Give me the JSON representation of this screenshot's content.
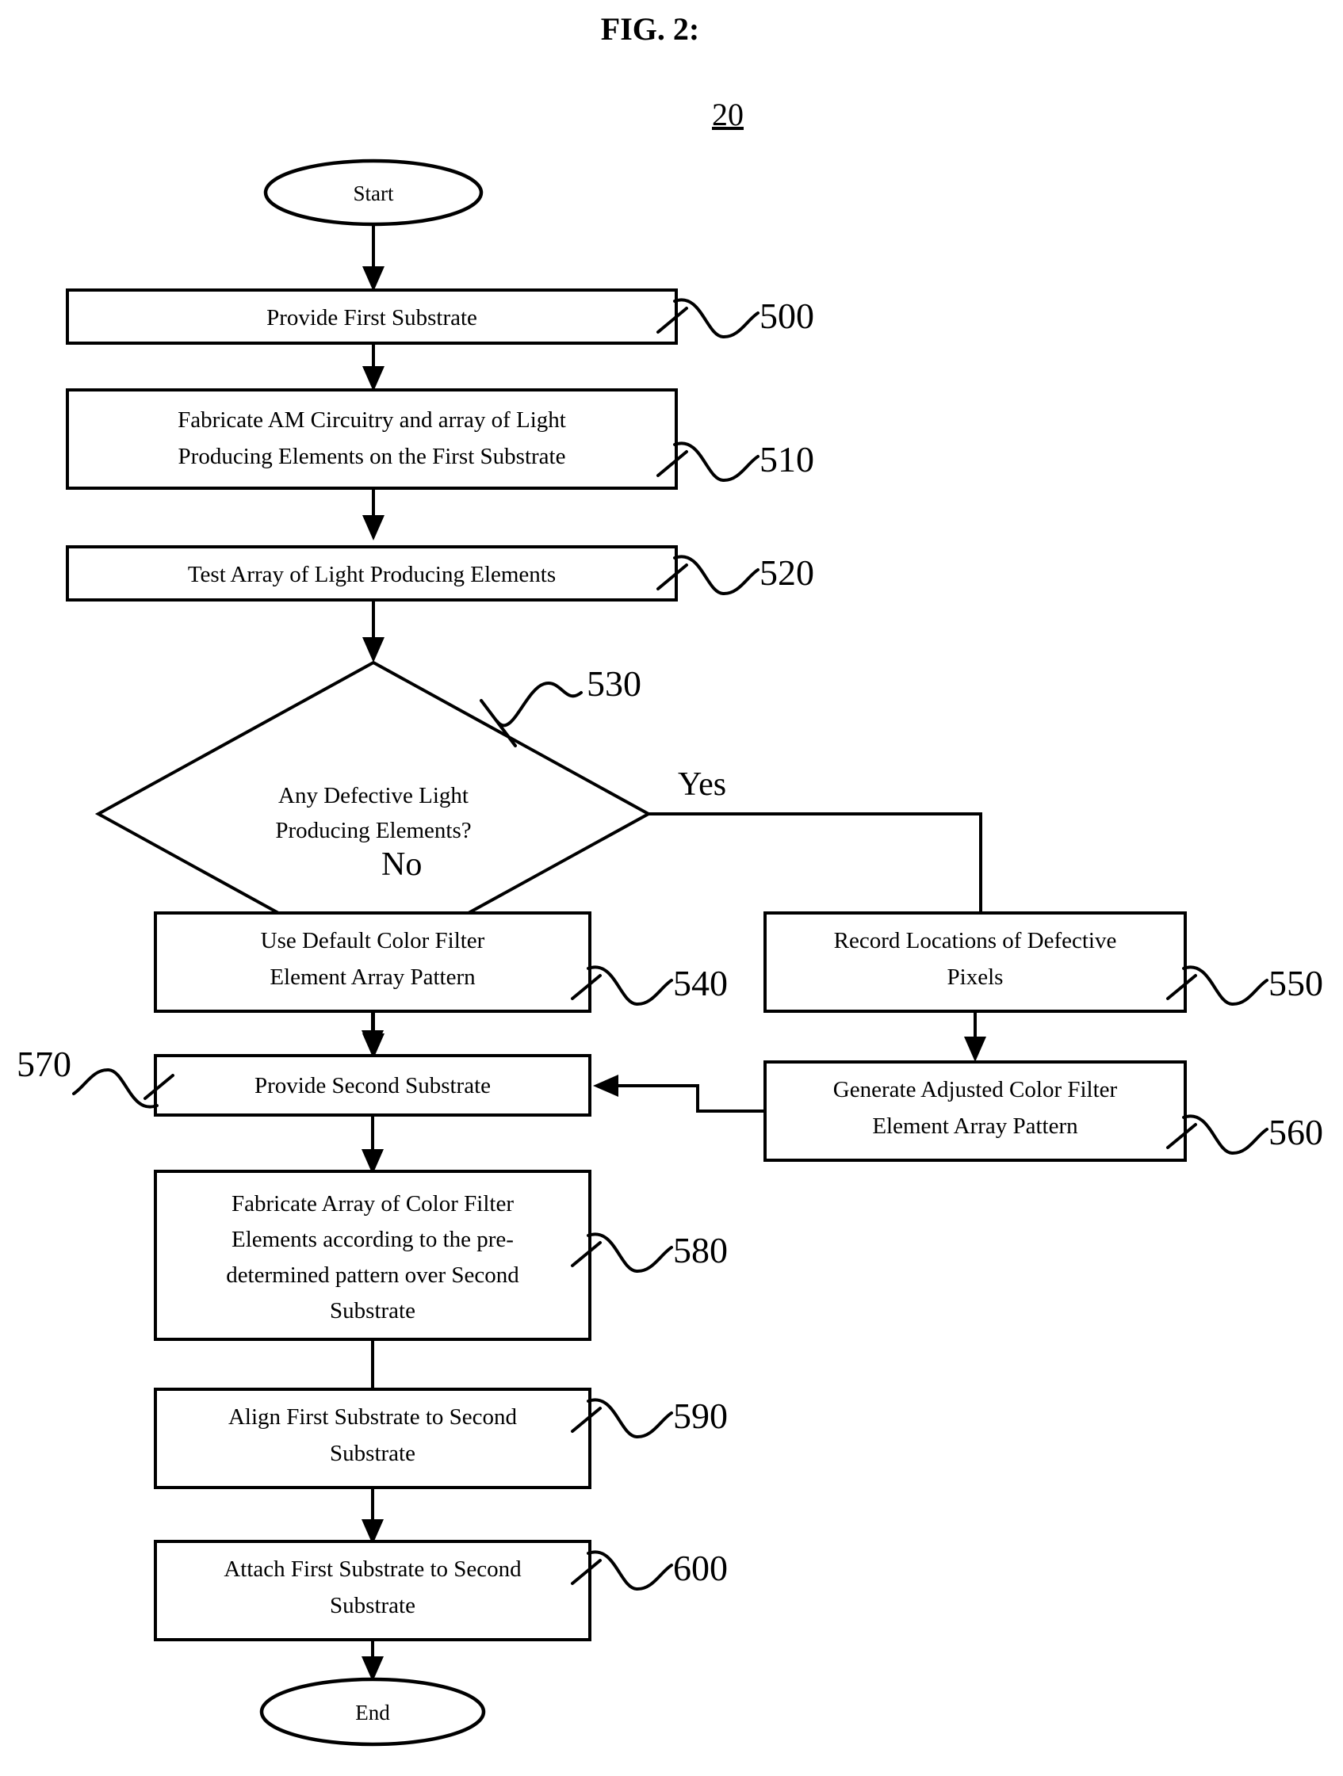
{
  "figure": {
    "title": "FIG. 2:",
    "diagram_number": "20"
  },
  "terminals": {
    "start": "Start",
    "end": "End"
  },
  "branch_labels": {
    "yes": "Yes",
    "no": "No"
  },
  "nodes": [
    {
      "id": "n500",
      "shape": "process",
      "lines": [
        "Provide First Substrate"
      ],
      "ref": "500"
    },
    {
      "id": "n510",
      "shape": "process",
      "lines": [
        "Fabricate AM Circuitry and array of Light",
        "Producing Elements on the First Substrate"
      ],
      "ref": "510"
    },
    {
      "id": "n520",
      "shape": "process",
      "lines": [
        "Test Array of Light Producing Elements"
      ],
      "ref": "520"
    },
    {
      "id": "n530",
      "shape": "decision",
      "lines": [
        "Any Defective Light",
        "Producing Elements?"
      ],
      "ref": "530"
    },
    {
      "id": "n540",
      "shape": "process",
      "lines": [
        "Use Default Color Filter",
        "Element Array Pattern"
      ],
      "ref": "540"
    },
    {
      "id": "n550",
      "shape": "process",
      "lines": [
        "Record Locations of Defective",
        "Pixels"
      ],
      "ref": "550"
    },
    {
      "id": "n570",
      "shape": "process",
      "lines": [
        "Provide Second Substrate"
      ],
      "ref": "570"
    },
    {
      "id": "n560",
      "shape": "process",
      "lines": [
        "Generate Adjusted Color Filter",
        "Element Array Pattern"
      ],
      "ref": "560"
    },
    {
      "id": "n580",
      "shape": "process",
      "lines": [
        "Fabricate Array of Color Filter",
        "Elements according to the pre-",
        "determined pattern over Second",
        "Substrate"
      ],
      "ref": "580"
    },
    {
      "id": "n590",
      "shape": "process",
      "lines": [
        "Align First Substrate to Second",
        "Substrate"
      ],
      "ref": "590"
    },
    {
      "id": "n600",
      "shape": "process",
      "lines": [
        "Attach First Substrate to Second",
        "Substrate"
      ],
      "ref": "600"
    }
  ],
  "colors": {
    "stroke": "#000000",
    "fill": "#ffffff",
    "background": "#ffffff"
  }
}
